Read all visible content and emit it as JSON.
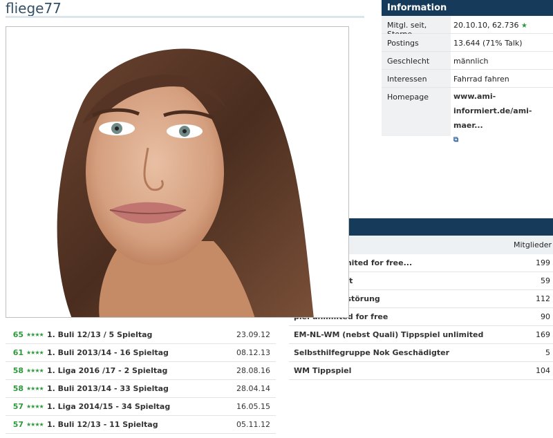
{
  "profile": {
    "username": "fliege77"
  },
  "info": {
    "title": "Information",
    "rows": [
      {
        "key": "Mitgl. seit, Sterne",
        "value": "20.10.10, 62.736"
      },
      {
        "key": "Postings",
        "value": "13.644 (71% Talk)"
      },
      {
        "key": "Geschlecht",
        "value": "männlich"
      },
      {
        "key": "Interessen",
        "value": "Fahrrad fahren"
      },
      {
        "key": "Homepage",
        "value_line1": "www.ami-",
        "value_line2": "informiert.de/ami-maer..."
      }
    ]
  },
  "groups": {
    "column_header": "Mitglieder",
    "rows": [
      {
        "name": "ppspiel unlimited for free...",
        "count": "199"
      },
      {
        "name": "Gemeinschaft",
        "count": "59"
      },
      {
        "name": "activ für Entstörung",
        "count": "112"
      },
      {
        "name": "piel unlimited for free",
        "count": "90"
      },
      {
        "name": "EM-NL-WM (nebst Quali) Tippspiel unlimited",
        "count": "169"
      },
      {
        "name": "Selbsthilfegruppe Nok Geschädigter",
        "count": "5"
      },
      {
        "name": "WM Tippspiel",
        "count": "104"
      }
    ]
  },
  "tipps": [
    {
      "points": "65",
      "title": "1. Buli 12/13 / 5 Spieltag",
      "date": "23.09.12"
    },
    {
      "points": "61",
      "title": "1. Buli 2013/14 - 16 Spieltag",
      "date": "08.12.13"
    },
    {
      "points": "58",
      "title": "1. Liga 2016 /17 - 2 Spieltag",
      "date": "28.08.16"
    },
    {
      "points": "58",
      "title": "1. Buli 2013/14 - 33 Spieltag",
      "date": "28.04.14"
    },
    {
      "points": "57",
      "title": "1. Liga 2014/15 - 34 Spieltag",
      "date": "16.05.15"
    },
    {
      "points": "57",
      "title": "1. Buli 12/13 - 11 Spieltag",
      "date": "05.11.12"
    }
  ],
  "colors": {
    "header_bg": "#163b5a",
    "accent_green": "#2c9a3a",
    "username": "#335067"
  }
}
